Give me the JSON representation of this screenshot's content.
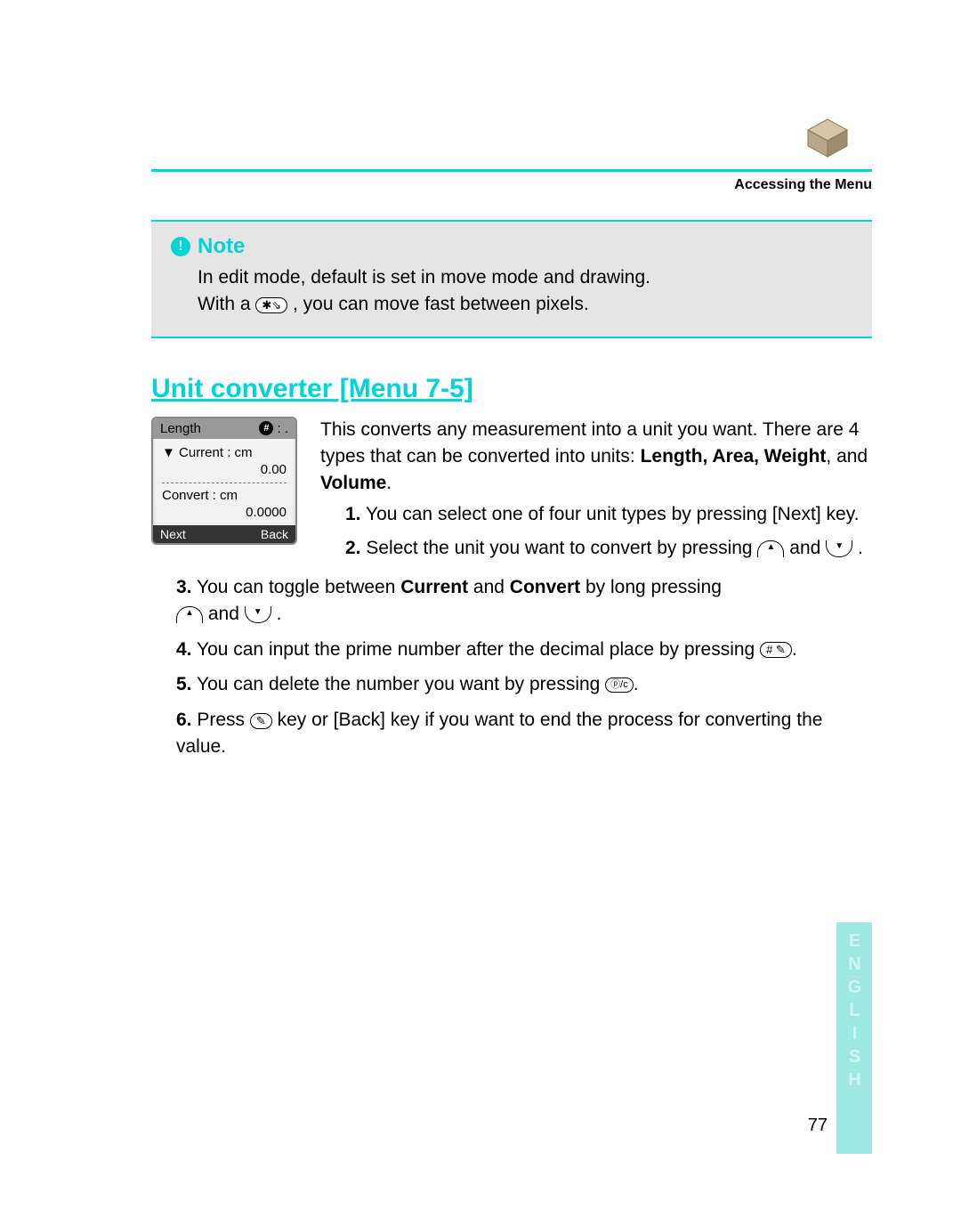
{
  "header": {
    "breadcrumb": "Accessing the Menu"
  },
  "note": {
    "label": "Note",
    "line1": "In edit mode, default is set in move mode and drawing.",
    "line2a": "With a ",
    "line2b": " , you can move fast between pixels.",
    "star_key": "✱⇘"
  },
  "section": {
    "title": "Unit converter [Menu 7-5]",
    "intro_a": "This converts any measurement into a unit you want. There are 4 types that can be converted into units: ",
    "intro_bold": "Length, Area, Weight",
    "intro_mid": ", and ",
    "intro_bold2": "Volume",
    "intro_end": "."
  },
  "screen": {
    "title": "Length",
    "badge": "#",
    "colon": ": .",
    "current_label": "▼ Current : cm",
    "current_val": "0.00",
    "convert_label": "Convert : cm",
    "convert_val": "0.0000",
    "sk_left": "Next",
    "sk_right": "Back"
  },
  "steps": {
    "s1": "You can select one of four unit types by pressing [Next] key.",
    "s2a": "Select the unit you want to convert by pressing ",
    "s2b": " and ",
    "s2c": " .",
    "s3a": "You can toggle between ",
    "s3b": "Current",
    "s3c": " and ",
    "s3d": "Convert",
    "s3e": " by long pressing ",
    "s3f": " and ",
    "s3g": " .",
    "s4a": "You can input the prime number after the decimal place by pressing ",
    "s4b": ".",
    "s5a": "You can delete the number you want by pressing ",
    "s5b": ".",
    "s6a": "Press ",
    "s6b": " key or [Back] key if you want to end the process for converting the value."
  },
  "keys": {
    "up": "▲",
    "down": "▼",
    "hash": "# ✎",
    "clear": "ⓟ/c",
    "end": "✎"
  },
  "footer": {
    "page": "77",
    "lang": "ENGLISH"
  }
}
